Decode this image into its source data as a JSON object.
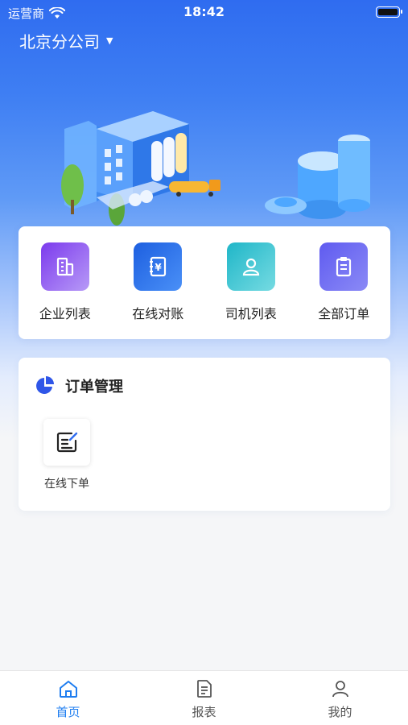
{
  "status_bar": {
    "carrier": "运营商",
    "time": "18:42"
  },
  "header": {
    "company": "北京分公司"
  },
  "quick_actions": [
    {
      "label": "企业列表",
      "icon": "building-icon",
      "color": "#7c3aed"
    },
    {
      "label": "在线对账",
      "icon": "yuan-notebook-icon",
      "color": "#1d5fe0"
    },
    {
      "label": "司机列表",
      "icon": "driver-icon",
      "color": "#1fb6c8"
    },
    {
      "label": "全部订单",
      "icon": "clipboard-icon",
      "color": "#5f5bf0"
    }
  ],
  "order_section": {
    "title": "订单管理",
    "items": [
      {
        "label": "在线下单",
        "icon": "edit-form-icon"
      }
    ]
  },
  "tab_bar": {
    "tabs": [
      {
        "label": "首页",
        "icon": "home-icon",
        "active": true
      },
      {
        "label": "报表",
        "icon": "report-icon",
        "active": false
      },
      {
        "label": "我的",
        "icon": "user-icon",
        "active": false
      }
    ],
    "active_color": "#1e7df0"
  },
  "colors": {
    "primary": "#2f6cf0",
    "accent": "#1e7df0"
  }
}
